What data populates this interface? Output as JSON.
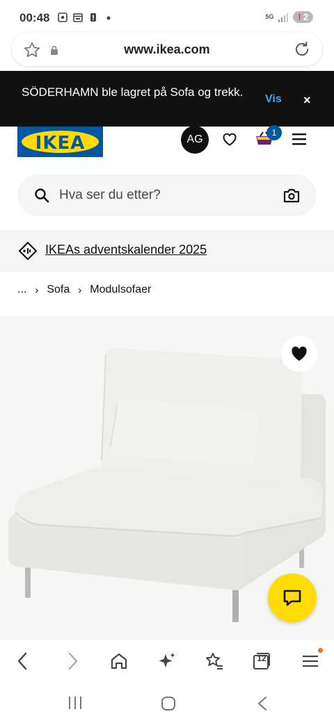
{
  "status_bar": {
    "time": "00:48",
    "network": "5G",
    "battery_text": "2",
    "battery_alert": "!"
  },
  "browser": {
    "url": "www.ikea.com",
    "tab_count": "12"
  },
  "toast": {
    "message": "SÖDERHAMN ble lagret på Sofa og trekk.",
    "action_label": "Vis",
    "close_label": "×"
  },
  "header": {
    "logo_text": "IKEA",
    "avatar_initials": "AG",
    "cart_count": "1"
  },
  "search": {
    "placeholder": "Hva ser du etter?"
  },
  "promo": {
    "link_text": "IKEAs adventskalender 2025"
  },
  "breadcrumb": {
    "items": [
      "...",
      "Sofa",
      "Modulsofaer"
    ]
  },
  "colors": {
    "ikea_blue": "#0058a3",
    "ikea_yellow": "#ffdb00",
    "toast_bg": "#111111",
    "toast_action": "#4ea3e8",
    "notification_dot": "#f26c23"
  },
  "icons": {
    "url_bar": [
      "bookmark-star-icon",
      "lock-icon",
      "reload-icon"
    ],
    "header": [
      "heart-icon",
      "cart-icon",
      "hamburger-menu-icon"
    ],
    "toolbar": [
      "back-icon",
      "forward-icon",
      "home-icon",
      "ai-sparkle-icon",
      "bookmarks-icon",
      "tabs-icon",
      "menu-icon"
    ],
    "nav": [
      "recents-icon",
      "home-circle-icon",
      "system-back-icon"
    ]
  }
}
